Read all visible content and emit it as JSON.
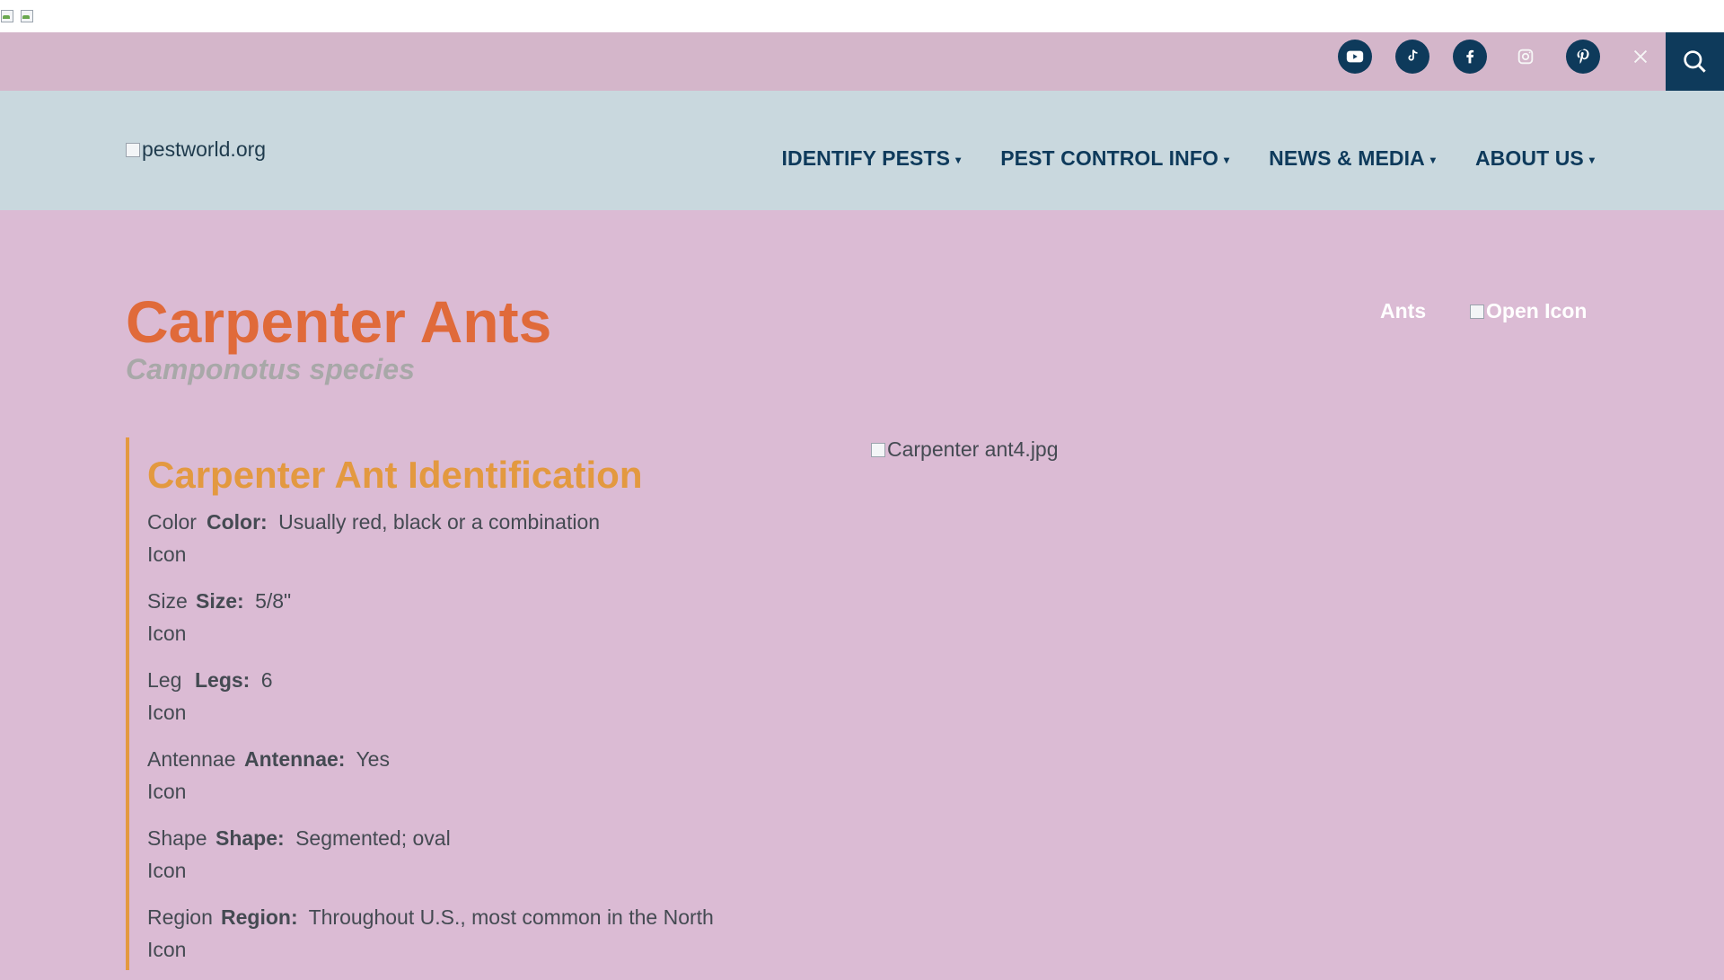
{
  "header": {
    "logo_alt": "pestworld.org",
    "nav": [
      {
        "label": "IDENTIFY PESTS",
        "caret": "▾"
      },
      {
        "label": "PEST CONTROL INFO",
        "caret": "▾"
      },
      {
        "label": "NEWS & MEDIA",
        "caret": "▾"
      },
      {
        "label": "ABOUT US",
        "caret": "▾"
      }
    ]
  },
  "social": [
    {
      "name": "youtube-icon"
    },
    {
      "name": "tiktok-icon"
    },
    {
      "name": "facebook-icon"
    },
    {
      "name": "instagram-icon"
    },
    {
      "name": "pinterest-icon"
    },
    {
      "name": "x-icon"
    }
  ],
  "page": {
    "title": "Carpenter Ants",
    "subtitle": "Camponotus species",
    "breadcrumb_ants": "Ants",
    "open_icon_alt": "Open Icon",
    "image_alt": "Carpenter ant4.jpg"
  },
  "identification": {
    "heading": "Carpenter Ant Identification",
    "traits": [
      {
        "icon_alt": "Color\nIcon",
        "label": "Color:",
        "value": "Usually red, black or a combination"
      },
      {
        "icon_alt": "Size\nIcon",
        "label": "Size:",
        "value": "5/8\""
      },
      {
        "icon_alt": "Leg\nIcon",
        "label": "Legs:",
        "value": "6"
      },
      {
        "icon_alt": "Antennae\nIcon",
        "label": "Antennae:",
        "value": "Yes"
      },
      {
        "icon_alt": "Shape\nIcon",
        "label": "Shape:",
        "value": "Segmented; oval"
      },
      {
        "icon_alt": "Region\nIcon",
        "label": "Region:",
        "value": "Throughout U.S., most common in the North"
      }
    ]
  },
  "colors": {
    "social_bar": "#d4b6ca",
    "header_bg": "#c9d8de",
    "navy": "#0e3a5b",
    "title_orange": "#e06a3a",
    "accent_orange": "#e39940",
    "page_bg": "#dbbbd4"
  }
}
